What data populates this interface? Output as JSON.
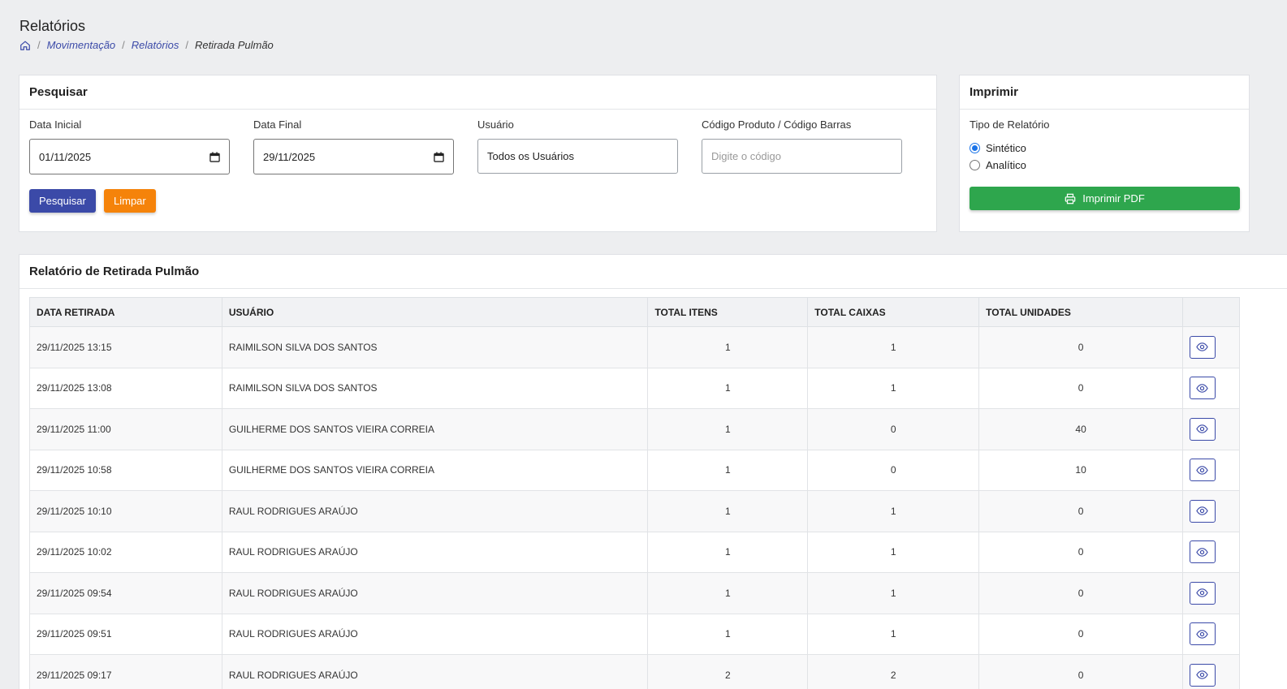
{
  "page": {
    "title": "Relatórios",
    "breadcrumb": [
      "Movimentação",
      "Relatórios",
      "Retirada Pulmão"
    ]
  },
  "search": {
    "header": "Pesquisar",
    "data_inicial_label": "Data Inicial",
    "data_inicial_value": "01/11/2025",
    "data_final_label": "Data Final",
    "data_final_value": "29/11/2025",
    "usuario_label": "Usuário",
    "usuario_value": "Todos os Usuários",
    "codigo_label": "Código Produto / Código Barras",
    "codigo_placeholder": "Digite o código",
    "pesquisar_label": "Pesquisar",
    "limpar_label": "Limpar"
  },
  "print": {
    "header": "Imprimir",
    "tipo_label": "Tipo de Relatório",
    "options": [
      "Sintético",
      "Analítico"
    ],
    "selected": "Sintético",
    "button_label": "Imprimir PDF"
  },
  "report": {
    "header": "Relatório de Retirada Pulmão",
    "columns": [
      "DATA RETIRADA",
      "USUÁRIO",
      "TOTAL ITENS",
      "TOTAL CAIXAS",
      "TOTAL UNIDADES"
    ],
    "rows": [
      [
        "29/11/2025 13:15",
        "RAIMILSON SILVA DOS SANTOS",
        "1",
        "1",
        "0"
      ],
      [
        "29/11/2025 13:08",
        "RAIMILSON SILVA DOS SANTOS",
        "1",
        "1",
        "0"
      ],
      [
        "29/11/2025 11:00",
        "GUILHERME DOS SANTOS VIEIRA CORREIA",
        "1",
        "0",
        "40"
      ],
      [
        "29/11/2025 10:58",
        "GUILHERME DOS SANTOS VIEIRA CORREIA",
        "1",
        "0",
        "10"
      ],
      [
        "29/11/2025 10:10",
        "RAUL RODRIGUES ARAÚJO",
        "1",
        "1",
        "0"
      ],
      [
        "29/11/2025 10:02",
        "RAUL RODRIGUES ARAÚJO",
        "1",
        "1",
        "0"
      ],
      [
        "29/11/2025 09:54",
        "RAUL RODRIGUES ARAÚJO",
        "1",
        "1",
        "0"
      ],
      [
        "29/11/2025 09:51",
        "RAUL RODRIGUES ARAÚJO",
        "1",
        "1",
        "0"
      ],
      [
        "29/11/2025 09:17",
        "RAUL RODRIGUES ARAÚJO",
        "2",
        "2",
        "0"
      ]
    ]
  },
  "colors": {
    "primary": "#3b4aa8",
    "orange": "#f5830a",
    "green": "#2ea64d"
  },
  "icons": {
    "breadcrumb_home": "home-icon",
    "date_picker": "calendar-icon",
    "print": "printer-icon",
    "row_action": "eye-icon"
  }
}
